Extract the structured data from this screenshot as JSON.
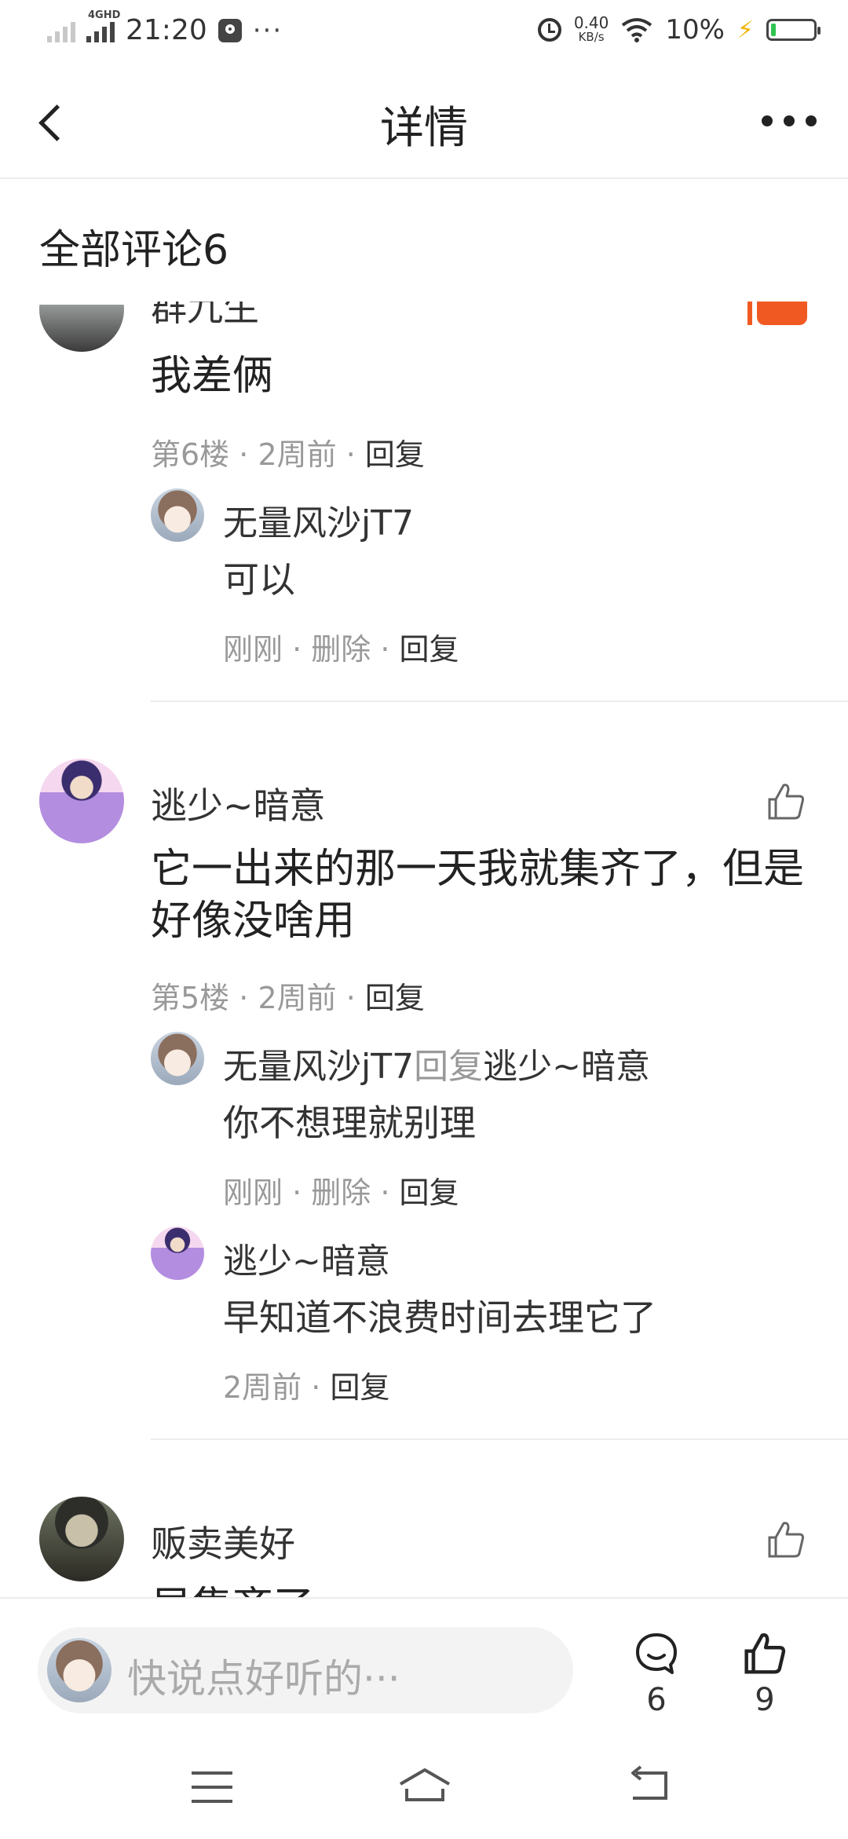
{
  "status_bar": {
    "network": "4GHD",
    "time": "21:20",
    "more": "···",
    "speed_value": "0.40",
    "speed_unit": "KB/s",
    "battery_percent": "10%",
    "battery_level": 0.1,
    "battery_color": "#2fc450"
  },
  "header": {
    "title": "详情"
  },
  "comments_section": {
    "title": "全部评论6"
  },
  "comments": [
    {
      "author": "群九生",
      "content": "我差俩",
      "floor": "第6楼",
      "time": "2周前",
      "reply_label": "回复",
      "replies": [
        {
          "author": "无量风沙jT7",
          "content": "可以",
          "time": "刚刚",
          "delete_label": "删除",
          "reply_label": "回复"
        }
      ]
    },
    {
      "author": "逃少~暗意",
      "content": "它一出来的那一天我就集齐了，但是好像没啥用",
      "floor": "第5楼",
      "time": "2周前",
      "reply_label": "回复",
      "replies": [
        {
          "author": "无量风沙jT7",
          "reply_to_label": "回复",
          "reply_to": "逃少~暗意",
          "content": "你不想理就别理",
          "time": "刚刚",
          "delete_label": "删除",
          "reply_label": "回复"
        },
        {
          "author": "逃少~暗意",
          "content": "早知道不浪费时间去理它了",
          "time": "2周前",
          "reply_label": "回复"
        }
      ]
    },
    {
      "author": "贩卖美好",
      "content": "早集齐了"
    }
  ],
  "bottom_bar": {
    "input_placeholder": "快说点好听的···",
    "comment_count": "6",
    "like_count": "9"
  },
  "accent_color": "#f05a22"
}
